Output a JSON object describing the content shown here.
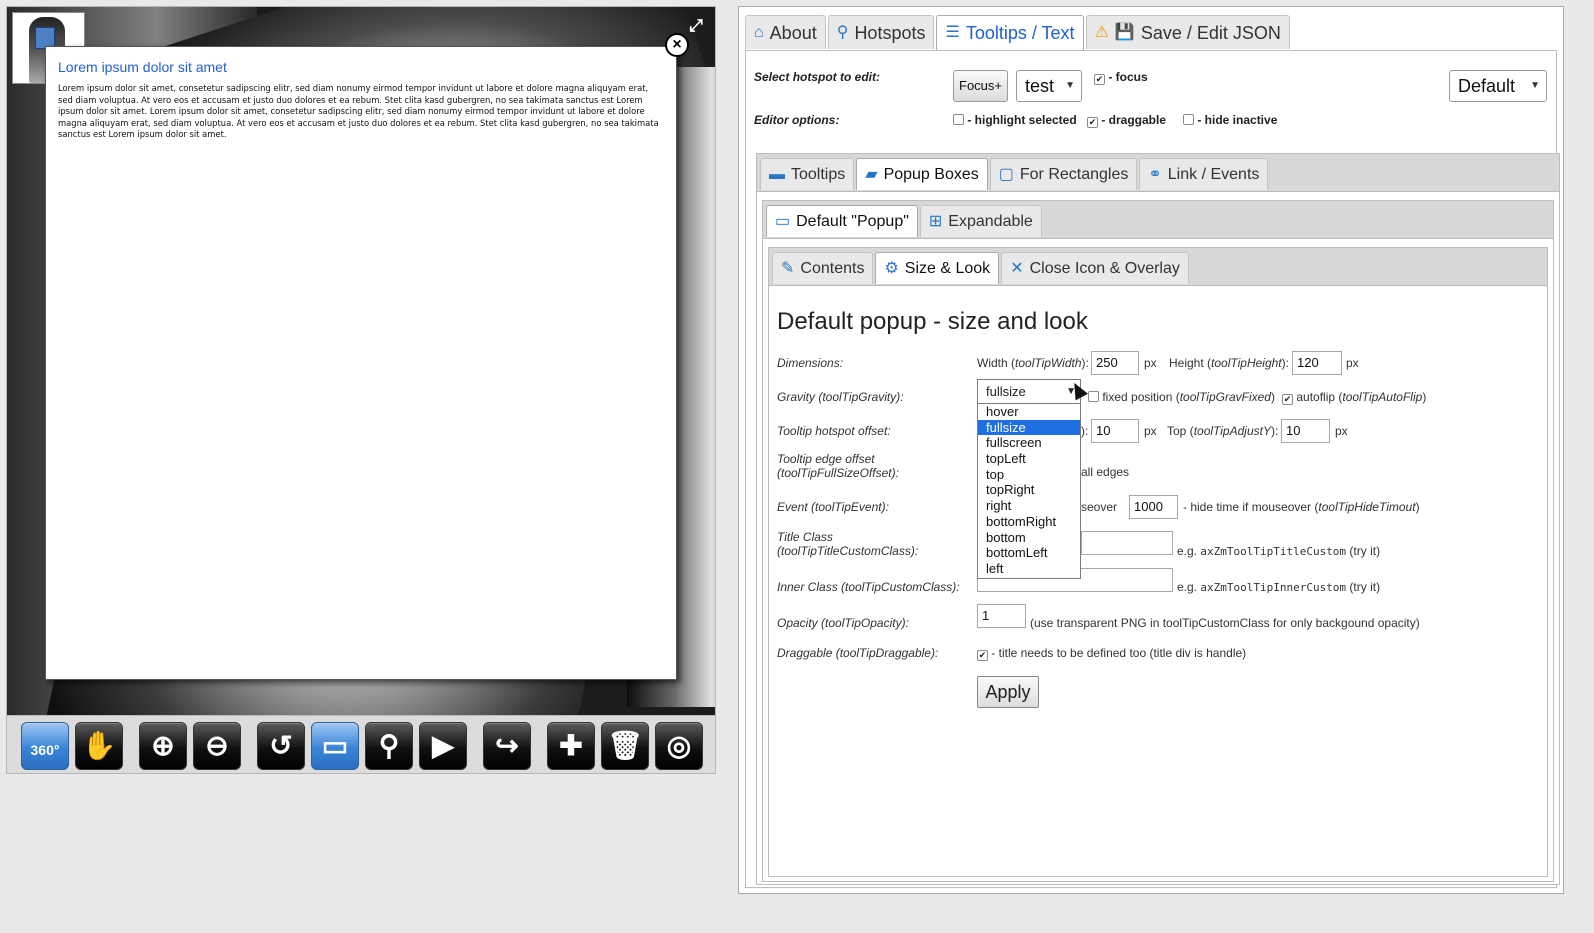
{
  "viewer": {
    "popup": {
      "title": "Lorem ipsum dolor sit amet",
      "body": "Lorem ipsum dolor sit amet, consetetur sadipscing elitr, sed diam nonumy eirmod tempor invidunt ut labore et dolore magna aliquyam erat, sed diam voluptua. At vero eos et accusam et justo duo dolores et ea rebum. Stet clita kasd gubergren, no sea takimata sanctus est Lorem ipsum dolor sit amet. Lorem ipsum dolor sit amet, consetetur sadipscing elitr, sed diam nonumy eirmod tempor invidunt ut labore et dolore magna aliquyam erat, sed diam voluptua. At vero eos et accusam et justo duo dolores et ea rebum. Stet clita kasd gubergren, no sea takimata sanctus est Lorem ipsum dolor sit amet."
    },
    "toolbar": [
      {
        "name": "360",
        "icon": "360-rotate-icon",
        "glyph": "360°",
        "active": true
      },
      {
        "name": "pan",
        "icon": "hand-icon",
        "glyph": "✋",
        "active": false
      },
      {
        "name": "zoom-in",
        "icon": "zoom-in-icon",
        "glyph": "⊕",
        "active": false
      },
      {
        "name": "zoom-out",
        "icon": "zoom-out-icon",
        "glyph": "⊖",
        "active": false
      },
      {
        "name": "reset",
        "icon": "reset-icon",
        "glyph": "↺",
        "active": false
      },
      {
        "name": "fullscreen",
        "icon": "monitor-icon",
        "glyph": "▭",
        "active": true
      },
      {
        "name": "hotspots",
        "icon": "map-pin-icon",
        "glyph": "⚲",
        "active": false
      },
      {
        "name": "play",
        "icon": "play-icon",
        "glyph": "▶",
        "active": false
      },
      {
        "name": "redo",
        "icon": "redo-icon",
        "glyph": "↪",
        "active": false
      },
      {
        "name": "add-hotspot",
        "icon": "add-pin-icon",
        "glyph": "✚",
        "active": false
      },
      {
        "name": "delete",
        "icon": "trash-icon",
        "glyph": "🗑",
        "active": false
      },
      {
        "name": "target",
        "icon": "target-icon",
        "glyph": "◎",
        "active": false
      }
    ]
  },
  "editor": {
    "main_tabs": [
      {
        "label": "About",
        "icon": "⌂"
      },
      {
        "label": "Hotspots",
        "icon": "⚲"
      },
      {
        "label": "Tooltips / Text",
        "icon": "☰"
      },
      {
        "label": "Save / Edit JSON",
        "icon": "⚠"
      }
    ],
    "select_hotspot_label": "Select hotspot to edit:",
    "focus_button": "Focus+",
    "hotspot_value": "test",
    "focus_label": "- focus",
    "preset_value": "Default",
    "editor_options_label": "Editor options:",
    "highlight_label": "- highlight selected",
    "draggable_label": "- draggable",
    "hide_inactive_label": "- hide inactive",
    "sub_tabs": [
      "Tooltips",
      "Popup Boxes",
      "For Rectangles",
      "Link / Events"
    ],
    "sub2_tabs": [
      "Default \"Popup\"",
      "Expandable"
    ],
    "sub3_tabs": [
      "Contents",
      "Size & Look",
      "Close Icon & Overlay"
    ],
    "form": {
      "title": "Default popup - size and look",
      "dimensions_label": "Dimensions:",
      "width_label": "Width (",
      "width_param": "toolTipWidth",
      "width_value": "250",
      "px": "px",
      "height_label": "Height (",
      "height_param": "toolTipHeight",
      "height_value": "120",
      "gravity_label": "Gravity (toolTipGravity):",
      "gravity_value": "fullsize",
      "gravity_options": [
        "hover",
        "fullsize",
        "fullscreen",
        "topLeft",
        "top",
        "topRight",
        "right",
        "bottomRight",
        "bottom",
        "bottomLeft",
        "left"
      ],
      "fixed_label": "fixed position (",
      "fixed_param": "toolTipGravFixed",
      "autoflip_label": "autoflip (",
      "autoflip_param": "toolTipAutoFlip",
      "hotspot_offset_label": "Tooltip hotspot offset:",
      "adjust_x_tail": "):",
      "adjust_x_value": "10",
      "top_label": "Top (",
      "top_param": "toolTipAdjustY",
      "adjust_y_value": "10",
      "edge_offset_label_1": "Tooltip edge offset",
      "edge_offset_label_2": "(toolTipFullSizeOffset):",
      "edge_tail": "all edges",
      "event_label": "Event (toolTipEvent):",
      "event_tail": "seover",
      "hide_time_value": "1000",
      "hide_time_label": "- hide time if mouseover (",
      "hide_time_param": "toolTipHideTimout",
      "title_class_label_1": "Title Class",
      "title_class_label_2": "(toolTipTitleCustomClass):",
      "title_class_eg": "e.g.",
      "title_class_example": "axZmToolTipTitleCustom",
      "try_it": "(try it)",
      "inner_class_label": "Inner Class (toolTipCustomClass):",
      "inner_class_example": "axZmToolTipInnerCustom",
      "opacity_label": "Opacity (toolTipOpacity):",
      "opacity_value": "1",
      "opacity_note": "(use transparent PNG in toolTipCustomClass for only backgound opacity)",
      "draggable_label": "Draggable (toolTipDraggable):",
      "draggable_note": "- title needs to be defined too (title div is handle)",
      "apply": "Apply"
    }
  }
}
